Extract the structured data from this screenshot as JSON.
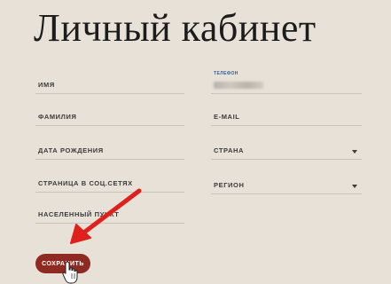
{
  "page": {
    "title": "Личный кабинет"
  },
  "form": {
    "left_fields": [
      {
        "label": "ИМЯ"
      },
      {
        "label": "ФАМИЛИЯ"
      },
      {
        "label": "ДАТА РОЖДЕНИЯ"
      },
      {
        "label": "СТРАНИЦА В СОЦ.СЕТЯХ"
      },
      {
        "label": "НАСЕЛЕННЫЙ ПУНКТ"
      }
    ],
    "phone": {
      "label": "ТЕЛЕФОН"
    },
    "email": {
      "label": "E-MAIL"
    },
    "country": {
      "label": "СТРАНА"
    },
    "region": {
      "label": "РЕГИОН"
    },
    "save_label": "СОХРАНИТЬ"
  },
  "colors": {
    "background": "#e7e1d8",
    "button": "#8f2a22",
    "arrow": "#e0201c"
  },
  "icons": {
    "pointer": "hand-pointer-icon",
    "arrow": "red-arrow-annotation",
    "dropdown": "chevron-down-icon"
  }
}
